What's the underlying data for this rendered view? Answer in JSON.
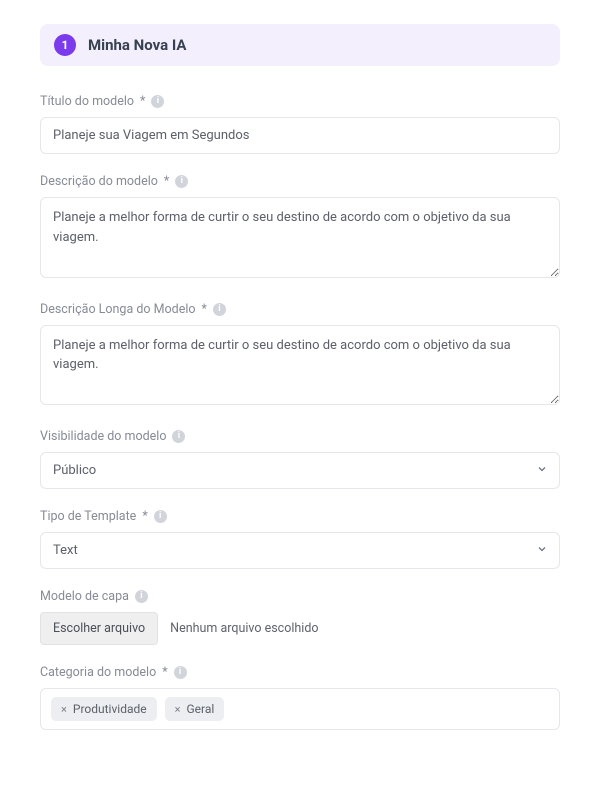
{
  "section": {
    "number": "1",
    "title": "Minha Nova IA"
  },
  "fields": {
    "title_label": "Título do modelo",
    "title_value": "Planeje sua Viagem em Segundos",
    "desc_label": "Descrição do modelo",
    "desc_value": "Planeje a melhor forma de curtir o seu destino de acordo com o objetivo da sua viagem.",
    "longdesc_label": "Descrição Longa do Modelo",
    "longdesc_value": "Planeje a melhor forma de curtir o seu destino de acordo com o objetivo da sua viagem.",
    "visibility_label": "Visibilidade do modelo",
    "visibility_value": "Público",
    "template_type_label": "Tipo de Template",
    "template_type_value": "Text",
    "cover_label": "Modelo de capa",
    "cover_button": "Escolher arquivo",
    "cover_status": "Nenhum arquivo escolhido",
    "category_label": "Categoria do modelo",
    "category_tags": [
      "Produtividade",
      "Geral"
    ]
  },
  "required_marker": "*"
}
